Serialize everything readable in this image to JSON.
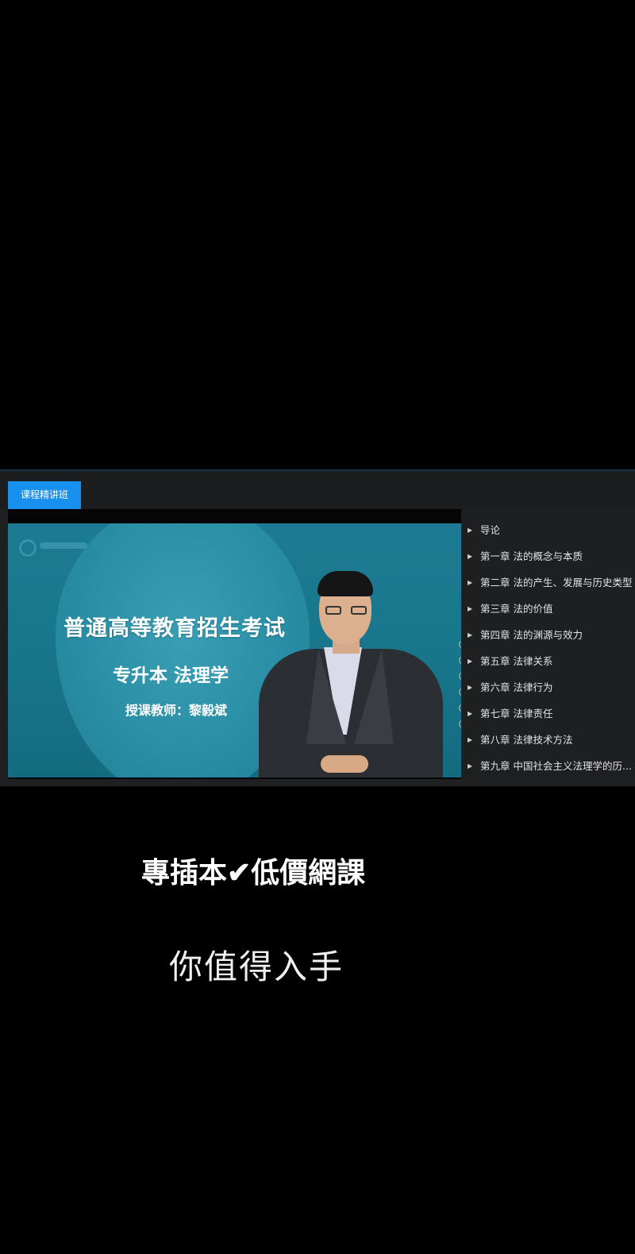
{
  "tab": {
    "label": "课程精讲班"
  },
  "slide": {
    "title": "普通高等教育招生考试",
    "subtitle": "专升本  法理学",
    "teacher": "授课教师：黎毅斌"
  },
  "chapters": [
    "导论",
    "第一章 法的概念与本质",
    "第二章 法的产生、发展与历史类型",
    "第三章 法的价值",
    "第四章 法的渊源与效力",
    "第五章 法律关系",
    "第六章 法律行为",
    "第七章 法律责任",
    "第八章 法律技术方法",
    "第九章 中国社会主义法理学的历..."
  ],
  "captions": {
    "line1": "專插本✔低價網課",
    "line2": "你值得入手"
  },
  "colors": {
    "tab_active": "#1890f0",
    "slide_bg": "#1d7a92"
  }
}
